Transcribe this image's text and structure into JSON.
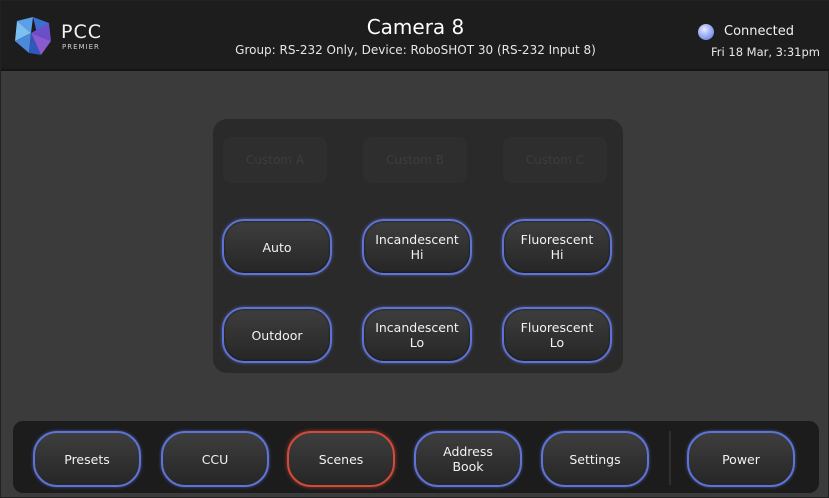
{
  "header": {
    "logo_text": "PCC",
    "logo_sub": "PREMIER",
    "title": "Camera 8",
    "subtitle": "Group: RS-232 Only,  Device: RoboSHOT 30 (RS-232 Input 8)",
    "status": "Connected",
    "datetime": "Fri 18 Mar, 3:31pm",
    "status_color": "#8e9ff0"
  },
  "panel": {
    "custom": [
      "Custom A",
      "Custom B",
      "Custom C"
    ],
    "buttons": [
      "Auto",
      "Incandescent\nHi",
      "Fluorescent\nHi",
      "Outdoor",
      "Incandescent\nLo",
      "Fluorescent\nLo"
    ]
  },
  "nav": {
    "items": [
      "Presets",
      "CCU",
      "Scenes",
      "Address\nBook",
      "Settings",
      "Power"
    ],
    "active": "Scenes",
    "accent": "#5d73d6",
    "active_color": "#d14a3a"
  }
}
